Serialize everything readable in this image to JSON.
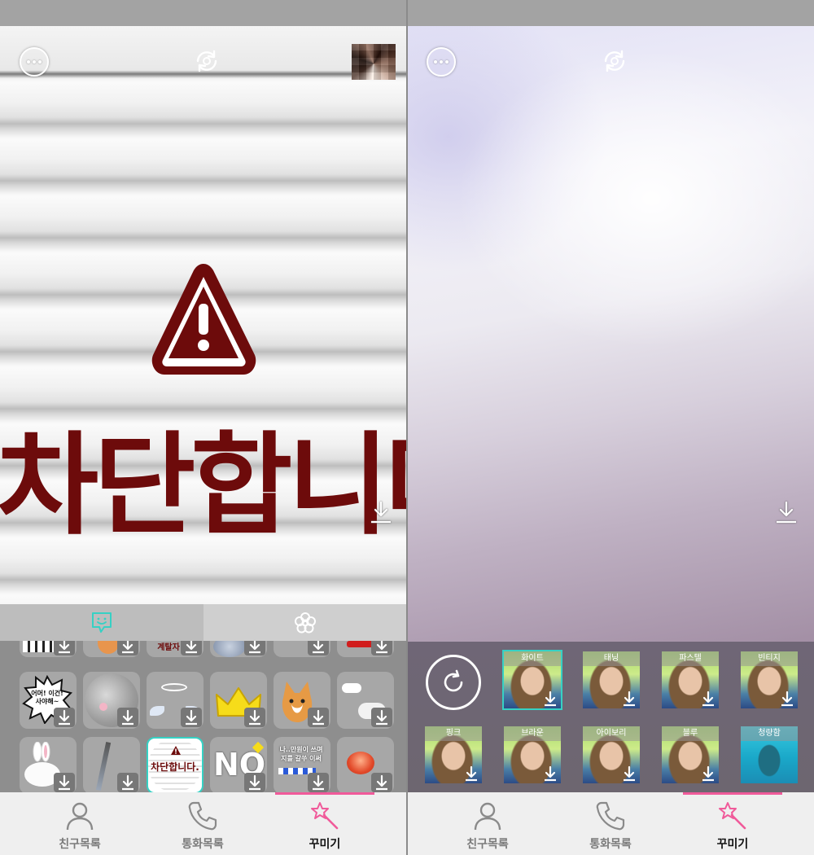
{
  "left": {
    "preview_text": "차단합니다.",
    "sticker_tabs": [
      {
        "name": "sticker-tab",
        "icon": "chat-sticker-icon",
        "active": true
      },
      {
        "name": "effect-tab",
        "icon": "flower-icon",
        "active": false
      }
    ],
    "stickers": {
      "speech_bubble_text": "어머! 이건! 사야해~",
      "sign_text": "계탈자",
      "selected_sticker_text": "차단합니다.",
      "no_sticker_text": "NO",
      "board_sticker_text": "나..만원이 쓰며 지를 갈쑤 이써"
    }
  },
  "right": {
    "filters": [
      {
        "label": "화이트",
        "selected": true
      },
      {
        "label": "태닝",
        "selected": false
      },
      {
        "label": "파스텔",
        "selected": false
      },
      {
        "label": "빈티지",
        "selected": false
      },
      {
        "label": "핑크",
        "selected": false
      },
      {
        "label": "브라운",
        "selected": false
      },
      {
        "label": "아이보리",
        "selected": false
      },
      {
        "label": "블루",
        "selected": false
      },
      {
        "label": "청량함",
        "selected": false
      }
    ]
  },
  "nav": {
    "friends": "친구목록",
    "calls": "통화목록",
    "decorate": "꾸미기"
  },
  "colors": {
    "accent": "#f05a9a",
    "teal": "#36d1c4",
    "block_text": "#6d0b0b"
  }
}
